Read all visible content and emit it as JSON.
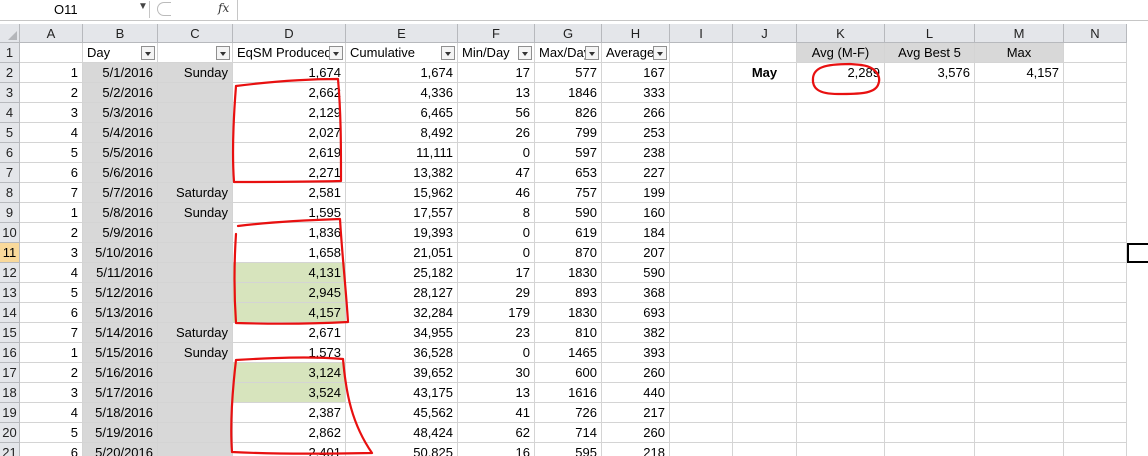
{
  "formula_bar": {
    "name_box": "O11",
    "fx_label": "fx",
    "formula": ""
  },
  "columns": [
    "A",
    "B",
    "C",
    "D",
    "E",
    "F",
    "G",
    "H",
    "I",
    "J",
    "K",
    "L",
    "M",
    "N"
  ],
  "headers": {
    "B": "Day",
    "C": "",
    "D": "EqSM Produced",
    "E": "Cumulative",
    "F": "Min/Day",
    "G": "Max/Day",
    "H": "Average",
    "K": "Avg (M-F)",
    "L": "Avg Best 5",
    "M": "Max"
  },
  "summary": {
    "label": "May",
    "avg_mf": "2,289",
    "avg_best5": "3,576",
    "max": "4,157"
  },
  "row_numbers": [
    "1",
    "2",
    "3",
    "4",
    "5",
    "6",
    "7",
    "8",
    "9",
    "10",
    "11",
    "12",
    "13",
    "14",
    "15",
    "16",
    "17",
    "18",
    "19",
    "20",
    "21"
  ],
  "rows": [
    {
      "a": "1",
      "b": "5/1/2016",
      "c": "Sunday",
      "d": "1,674",
      "e": "1,674",
      "f": "17",
      "g": "577",
      "h": "167",
      "green": false
    },
    {
      "a": "2",
      "b": "5/2/2016",
      "c": "",
      "d": "2,662",
      "e": "4,336",
      "f": "13",
      "g": "1846",
      "h": "333",
      "green": false
    },
    {
      "a": "3",
      "b": "5/3/2016",
      "c": "",
      "d": "2,129",
      "e": "6,465",
      "f": "56",
      "g": "826",
      "h": "266",
      "green": false
    },
    {
      "a": "4",
      "b": "5/4/2016",
      "c": "",
      "d": "2,027",
      "e": "8,492",
      "f": "26",
      "g": "799",
      "h": "253",
      "green": false
    },
    {
      "a": "5",
      "b": "5/5/2016",
      "c": "",
      "d": "2,619",
      "e": "11,111",
      "f": "0",
      "g": "597",
      "h": "238",
      "green": false
    },
    {
      "a": "6",
      "b": "5/6/2016",
      "c": "",
      "d": "2,271",
      "e": "13,382",
      "f": "47",
      "g": "653",
      "h": "227",
      "green": false
    },
    {
      "a": "7",
      "b": "5/7/2016",
      "c": "Saturday",
      "d": "2,581",
      "e": "15,962",
      "f": "46",
      "g": "757",
      "h": "199",
      "green": false
    },
    {
      "a": "1",
      "b": "5/8/2016",
      "c": "Sunday",
      "d": "1,595",
      "e": "17,557",
      "f": "8",
      "g": "590",
      "h": "160",
      "green": false
    },
    {
      "a": "2",
      "b": "5/9/2016",
      "c": "",
      "d": "1,836",
      "e": "19,393",
      "f": "0",
      "g": "619",
      "h": "184",
      "green": false
    },
    {
      "a": "3",
      "b": "5/10/2016",
      "c": "",
      "d": "1,658",
      "e": "21,051",
      "f": "0",
      "g": "870",
      "h": "207",
      "green": false
    },
    {
      "a": "4",
      "b": "5/11/2016",
      "c": "",
      "d": "4,131",
      "e": "25,182",
      "f": "17",
      "g": "1830",
      "h": "590",
      "green": true
    },
    {
      "a": "5",
      "b": "5/12/2016",
      "c": "",
      "d": "2,945",
      "e": "28,127",
      "f": "29",
      "g": "893",
      "h": "368",
      "green": true
    },
    {
      "a": "6",
      "b": "5/13/2016",
      "c": "",
      "d": "4,157",
      "e": "32,284",
      "f": "179",
      "g": "1830",
      "h": "693",
      "green": true
    },
    {
      "a": "7",
      "b": "5/14/2016",
      "c": "Saturday",
      "d": "2,671",
      "e": "34,955",
      "f": "23",
      "g": "810",
      "h": "382",
      "green": false
    },
    {
      "a": "1",
      "b": "5/15/2016",
      "c": "Sunday",
      "d": "1,573",
      "e": "36,528",
      "f": "0",
      "g": "1465",
      "h": "393",
      "green": false
    },
    {
      "a": "2",
      "b": "5/16/2016",
      "c": "",
      "d": "3,124",
      "e": "39,652",
      "f": "30",
      "g": "600",
      "h": "260",
      "green": true
    },
    {
      "a": "3",
      "b": "5/17/2016",
      "c": "",
      "d": "3,524",
      "e": "43,175",
      "f": "13",
      "g": "1616",
      "h": "440",
      "green": true
    },
    {
      "a": "4",
      "b": "5/18/2016",
      "c": "",
      "d": "2,387",
      "e": "45,562",
      "f": "41",
      "g": "726",
      "h": "217",
      "green": false
    },
    {
      "a": "5",
      "b": "5/19/2016",
      "c": "",
      "d": "2,862",
      "e": "48,424",
      "f": "62",
      "g": "714",
      "h": "260",
      "green": false
    },
    {
      "a": "6",
      "b": "5/20/2016",
      "c": "",
      "d": "2,401",
      "e": "50,825",
      "f": "16",
      "g": "595",
      "h": "218",
      "green": false
    }
  ],
  "colors": {
    "header_bg": "#e4e6ea",
    "day_col_grey": "#d8d8d8",
    "highlight_green": "#d7e4bd",
    "selected_row_header": "#f9d99a",
    "annotation_red": "#e81010"
  }
}
